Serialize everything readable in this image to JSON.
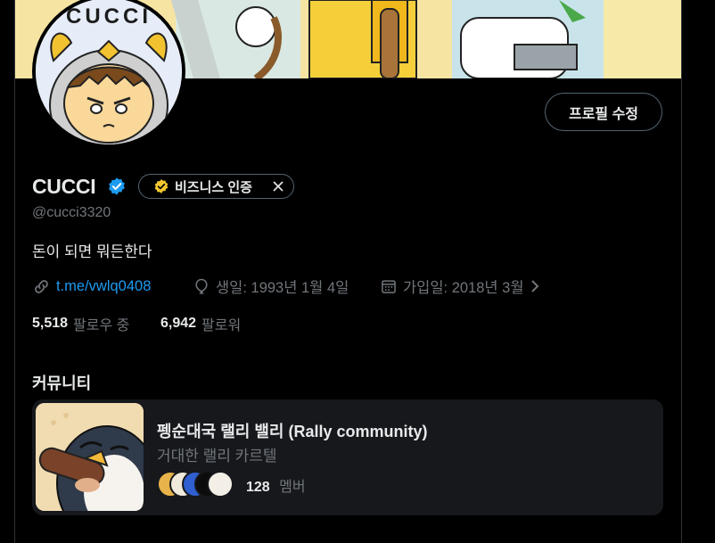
{
  "banner": {
    "art_text": "CUCCI"
  },
  "profile": {
    "edit_button": "프로필 수정",
    "display_name": "CUCCI",
    "badge_label": "비즈니스 인증",
    "handle": "@cucci3320",
    "bio": "돈이 되면 뭐든한다",
    "link": "t.me/vwlq0408",
    "birthday": "생일: 1993년 1월 4일",
    "joined": "가입일: 2018년 3월",
    "following_count": "5,518",
    "following_label": "팔로우 중",
    "followers_count": "6,942",
    "followers_label": "팔로워"
  },
  "communities": {
    "heading": "커뮤니티",
    "items": [
      {
        "name": "펭순대국 랠리 밸리 (Rally community)",
        "description": "거대한 랠리 카르텔",
        "member_count": "128",
        "member_label": "멤버"
      }
    ]
  },
  "colors": {
    "accent": "#1d9bf0",
    "verified_gold": "#f4c82e",
    "text_secondary": "#71767b"
  },
  "icons": [
    "verified-icon",
    "business-badge-icon",
    "close-icon",
    "link-icon",
    "balloon-icon",
    "calendar-icon",
    "chevron-right-icon"
  ]
}
